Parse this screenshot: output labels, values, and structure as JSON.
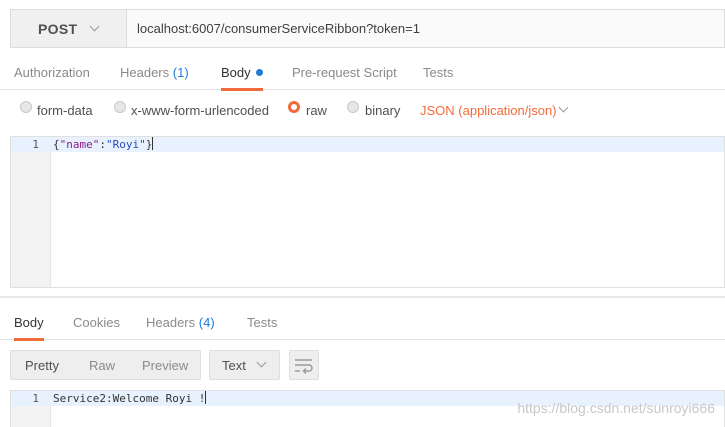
{
  "request": {
    "method": "POST",
    "url": "localhost:6007/consumerServiceRibbon?token=1",
    "tabs": [
      {
        "label": "Authorization",
        "count": ""
      },
      {
        "label": "Headers",
        "count": "(1)"
      },
      {
        "label": "Body",
        "count": ""
      },
      {
        "label": "Pre-request Script",
        "count": ""
      },
      {
        "label": "Tests",
        "count": ""
      }
    ],
    "active_tab": "Body",
    "body_modes": [
      "form-data",
      "x-www-form-urlencoded",
      "raw",
      "binary"
    ],
    "selected_mode": "raw",
    "content_type": "JSON (application/json)",
    "editor": {
      "line_number": "1",
      "code_open": "{",
      "code_key": "\"name\"",
      "code_colon": ":",
      "code_value": "\"Royi\"",
      "code_close": "}"
    }
  },
  "response": {
    "tabs": [
      {
        "label": "Body",
        "count": ""
      },
      {
        "label": "Cookies",
        "count": ""
      },
      {
        "label": "Headers",
        "count": "(4)"
      },
      {
        "label": "Tests",
        "count": ""
      }
    ],
    "active_tab": "Body",
    "view_modes": [
      "Pretty",
      "Raw",
      "Preview"
    ],
    "selected_view": "Pretty",
    "format": "Text",
    "editor": {
      "line_number": "1",
      "text": "Service2:Welcome Royi !"
    }
  },
  "watermark": "https://blog.csdn.net/sunroyi666",
  "colors": {
    "accent": "#f26b3a",
    "link": "#1f7bd4"
  }
}
